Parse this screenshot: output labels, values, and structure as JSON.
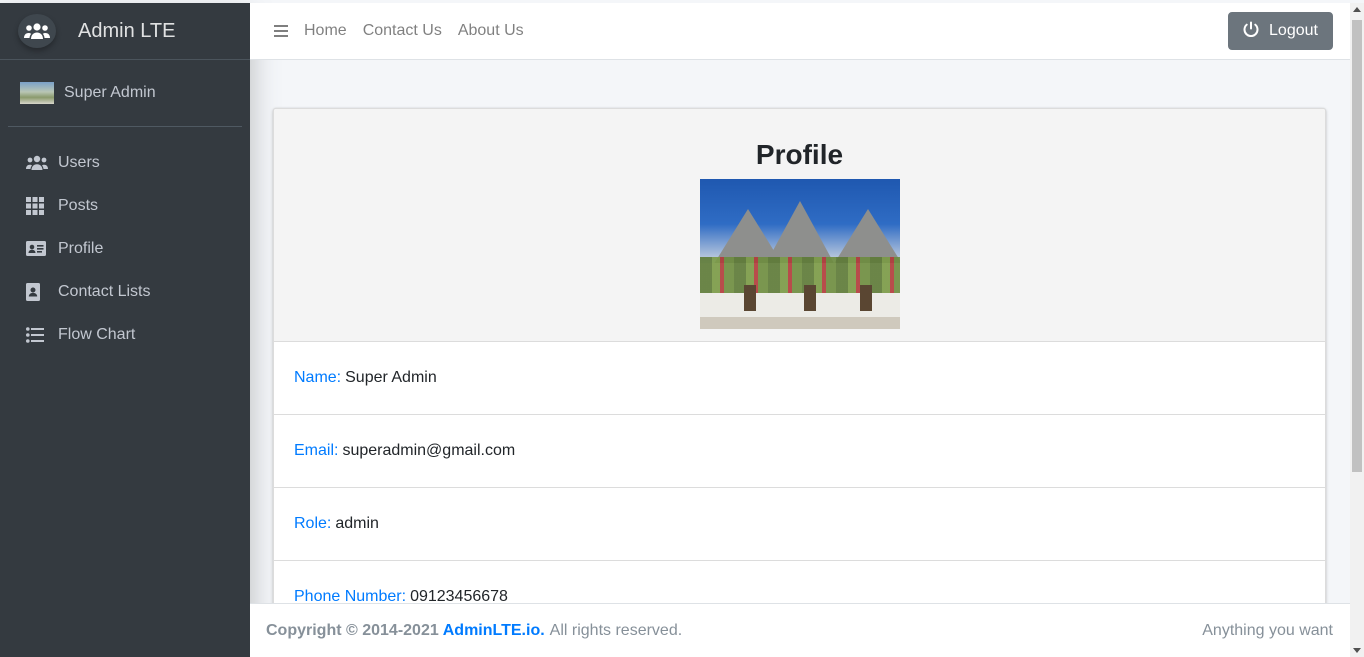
{
  "brand": {
    "title": "Admin LTE",
    "logo_icon": "users-group-icon"
  },
  "user": {
    "name": "Super Admin"
  },
  "sidebar": {
    "items": [
      {
        "label": "Users",
        "icon": "users-icon"
      },
      {
        "label": "Posts",
        "icon": "grid-icon"
      },
      {
        "label": "Profile",
        "icon": "id-card-icon"
      },
      {
        "label": "Contact Lists",
        "icon": "address-book-icon"
      },
      {
        "label": "Flow Chart",
        "icon": "list-icon"
      }
    ]
  },
  "topbar": {
    "links": [
      "Home",
      "Contact Us",
      "About Us"
    ],
    "logout_label": "Logout"
  },
  "profile": {
    "title": "Profile",
    "fields": [
      {
        "label": "Name:",
        "value": "Super Admin"
      },
      {
        "label": "Email:",
        "value": "superadmin@gmail.com"
      },
      {
        "label": "Role:",
        "value": "admin"
      },
      {
        "label": "Phone Number:",
        "value": "09123456678"
      }
    ]
  },
  "footer": {
    "copyright": "Copyright © 2014-2021",
    "brand_link": "AdminLTE.io.",
    "rights": "All rights reserved.",
    "right_text": "Anything you want"
  },
  "colors": {
    "sidebar_bg": "#343a40",
    "link_blue": "#007bff",
    "logout_bg": "#6c757d"
  }
}
